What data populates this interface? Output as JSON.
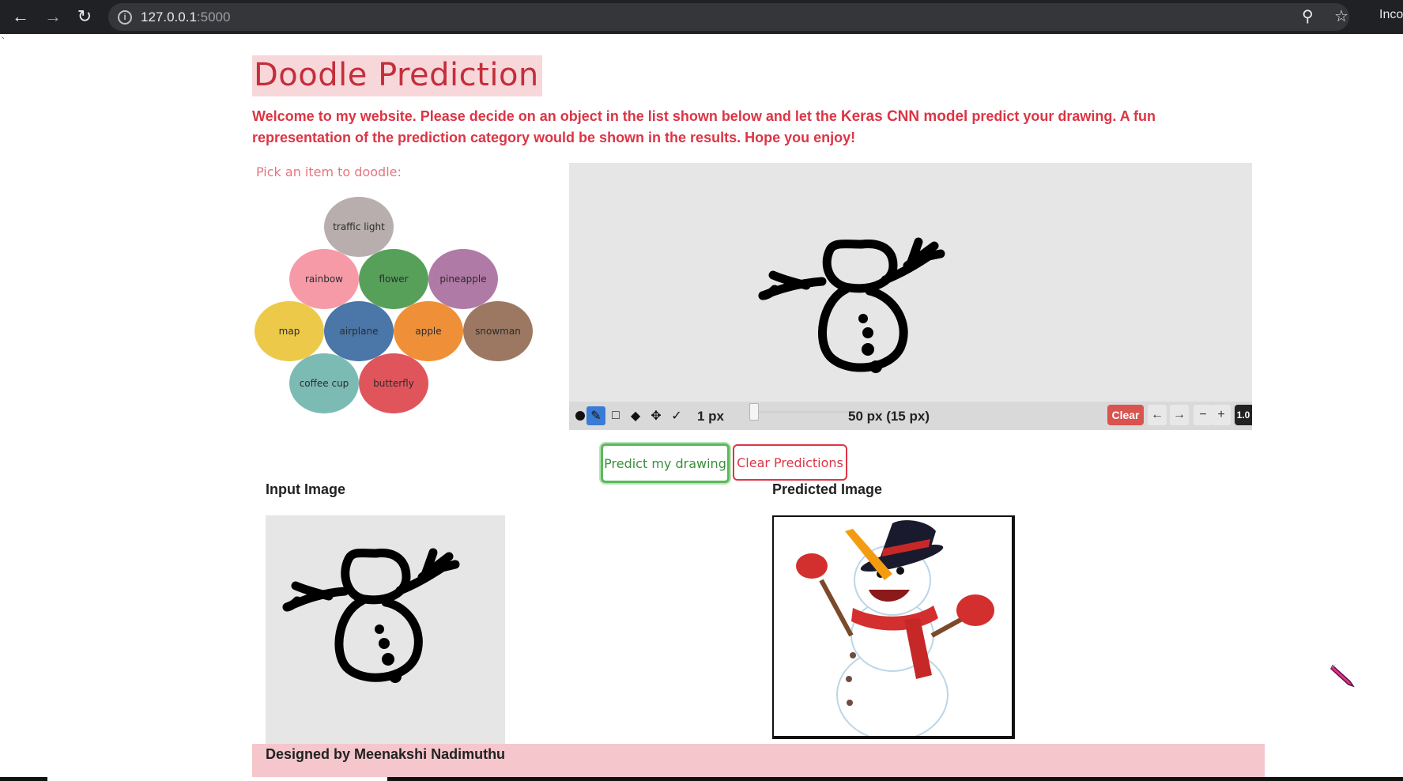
{
  "browser": {
    "url_host": "127.0.0.1",
    "url_port": ":5000",
    "profile_label": "Incognito"
  },
  "stray_char": "`",
  "page": {
    "title": "Doodle Prediction",
    "intro_part1": "Welcome to my website. Please decide on an object in the list shown below and let the ",
    "intro_highlight": "Keras CNN model",
    "intro_part2": " predict your drawing. A fun representation of the prediction category would be shown in the results. Hope you enjoy!",
    "pick_label": "Pick an item to doodle:",
    "items": [
      {
        "label": "traffic light",
        "color": "#b8aeae"
      },
      {
        "label": "rainbow",
        "color": "#f79aa8"
      },
      {
        "label": "flower",
        "color": "#57a05a"
      },
      {
        "label": "pineapple",
        "color": "#b07aa6"
      },
      {
        "label": "map",
        "color": "#ecc948"
      },
      {
        "label": "airplane",
        "color": "#4a76a8"
      },
      {
        "label": "apple",
        "color": "#ef9038"
      },
      {
        "label": "snowman",
        "color": "#9c7862"
      },
      {
        "label": "coffee cup",
        "color": "#7cbbb4"
      },
      {
        "label": "butterfly",
        "color": "#e0555c"
      }
    ]
  },
  "toolbar": {
    "stroke_size": "1 px",
    "brush_size": "50 px (15 px)",
    "clear_label": "Clear",
    "undo_symbol": "←",
    "redo_symbol": "→",
    "zoom_out_symbol": "−",
    "zoom_in_symbol": "+",
    "zoom_value": "1.0"
  },
  "actions": {
    "predict_label": "Predict my drawing",
    "clear_predictions_label": "Clear Predictions"
  },
  "results": {
    "input_header": "Input Image",
    "predicted_header": "Predicted Image"
  },
  "footer": {
    "credit": "Designed by Meenakshi Nadimuthu"
  },
  "colors": {
    "accent_red": "#dc3545",
    "predict_green": "#5cb85c",
    "footer_bg": "#f5c6cb"
  }
}
